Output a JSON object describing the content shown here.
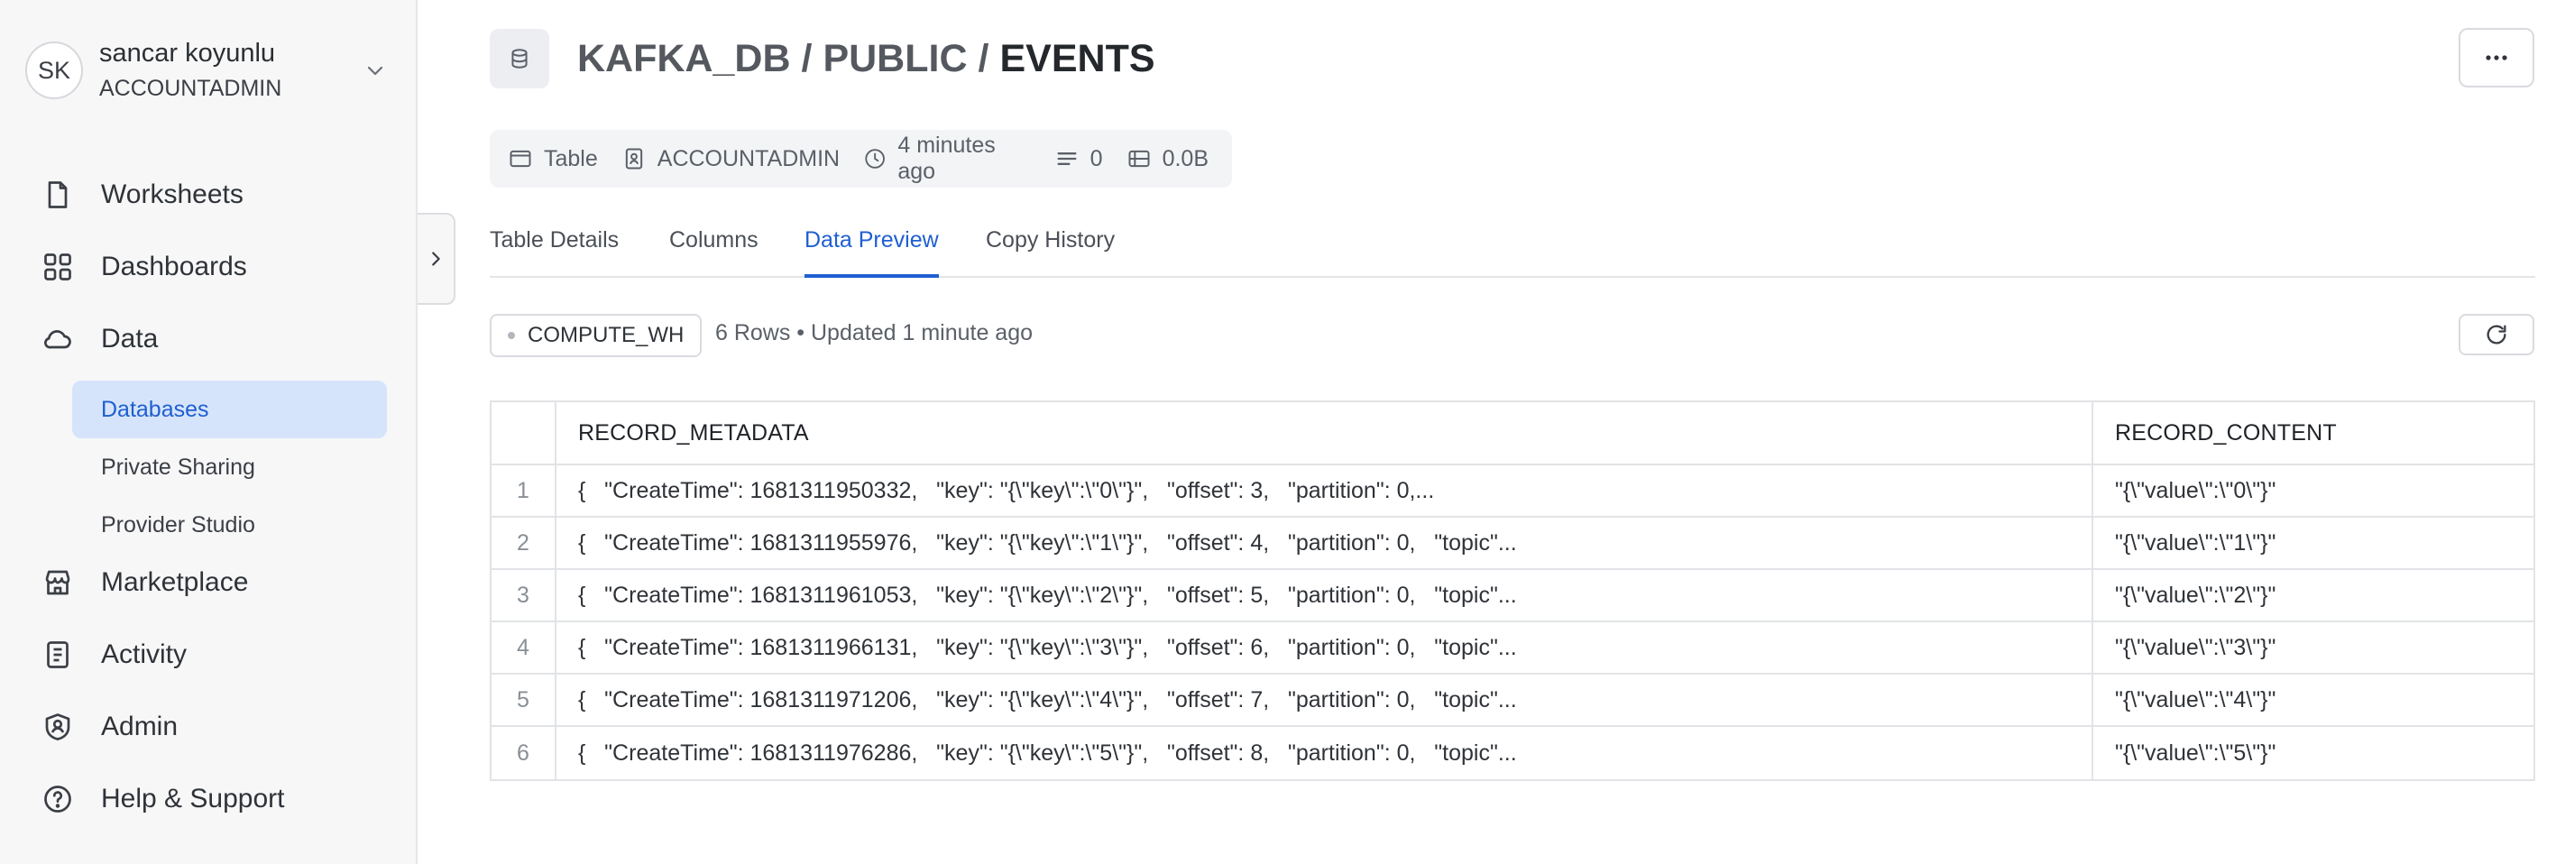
{
  "user": {
    "initials": "SK",
    "name": "sancar koyunlu",
    "role": "ACCOUNTADMIN"
  },
  "nav": {
    "worksheets": "Worksheets",
    "dashboards": "Dashboards",
    "data": "Data",
    "databases": "Databases",
    "private_sharing": "Private Sharing",
    "provider_studio": "Provider Studio",
    "marketplace": "Marketplace",
    "activity": "Activity",
    "admin": "Admin",
    "help": "Help & Support"
  },
  "breadcrumb": {
    "db": "KAFKA_DB",
    "sep1": "/",
    "schema": "PUBLIC",
    "sep2": "/",
    "table": "EVENTS"
  },
  "meta": {
    "type": "Table",
    "owner": "ACCOUNTADMIN",
    "created": "4 minutes ago",
    "rows": "0",
    "size": "0.0B"
  },
  "tabs": {
    "details": "Table Details",
    "columns": "Columns",
    "preview": "Data Preview",
    "history": "Copy History"
  },
  "warehouse": "COMPUTE_WH",
  "rows_info": "6 Rows • Updated 1 minute ago",
  "table": {
    "headers": [
      "RECORD_METADATA",
      "RECORD_CONTENT"
    ],
    "rows": [
      {
        "n": "1",
        "meta": "{   \"CreateTime\": 1681311950332,   \"key\": \"{\\\"key\\\":\\\"0\\\"}\",   \"offset\": 3,   \"partition\": 0,...",
        "content": "\"{\\\"value\\\":\\\"0\\\"}\""
      },
      {
        "n": "2",
        "meta": "{   \"CreateTime\": 1681311955976,   \"key\": \"{\\\"key\\\":\\\"1\\\"}\",   \"offset\": 4,   \"partition\": 0,   \"topic\"...",
        "content": "\"{\\\"value\\\":\\\"1\\\"}\""
      },
      {
        "n": "3",
        "meta": "{   \"CreateTime\": 1681311961053,   \"key\": \"{\\\"key\\\":\\\"2\\\"}\",   \"offset\": 5,   \"partition\": 0,   \"topic\"...",
        "content": "\"{\\\"value\\\":\\\"2\\\"}\""
      },
      {
        "n": "4",
        "meta": "{   \"CreateTime\": 1681311966131,   \"key\": \"{\\\"key\\\":\\\"3\\\"}\",   \"offset\": 6,   \"partition\": 0,   \"topic\"...",
        "content": "\"{\\\"value\\\":\\\"3\\\"}\""
      },
      {
        "n": "5",
        "meta": "{   \"CreateTime\": 1681311971206,   \"key\": \"{\\\"key\\\":\\\"4\\\"}\",   \"offset\": 7,   \"partition\": 0,   \"topic\"...",
        "content": "\"{\\\"value\\\":\\\"4\\\"}\""
      },
      {
        "n": "6",
        "meta": "{   \"CreateTime\": 1681311976286,   \"key\": \"{\\\"key\\\":\\\"5\\\"}\",   \"offset\": 8,   \"partition\": 0,   \"topic\"...",
        "content": "\"{\\\"value\\\":\\\"5\\\"}\""
      }
    ]
  },
  "colors": {
    "accent": "#1f5fd0",
    "active_bg": "#d6e4fb",
    "sidebar_bg": "#f7f7f8"
  }
}
